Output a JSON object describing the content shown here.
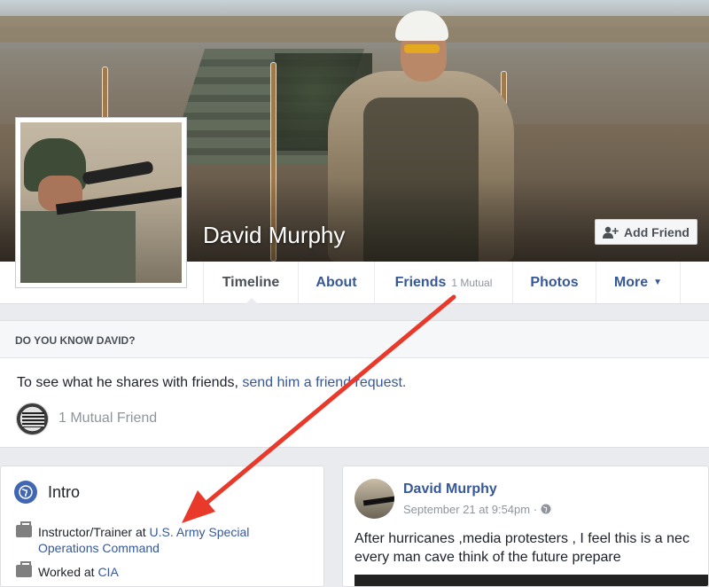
{
  "profile": {
    "name": "David Murphy",
    "add_friend_label": "Add Friend"
  },
  "tabs": [
    {
      "label": "Timeline",
      "active": true
    },
    {
      "label": "About"
    },
    {
      "label": "Friends",
      "sub": "1 Mutual"
    },
    {
      "label": "Photos"
    },
    {
      "label": "More"
    }
  ],
  "know_card": {
    "header": "DO YOU KNOW DAVID?",
    "text_prefix": "To see what he shares with friends, ",
    "link_text": "send him a friend request.",
    "mutual_label": "1 Mutual Friend"
  },
  "intro": {
    "title": "Intro",
    "line1_prefix": "Instructor/Trainer at ",
    "line1_link_a": "U.S. Army Special",
    "line1_link_b": "Operations Command",
    "line2_prefix": "Worked at ",
    "line2_link": "CIA"
  },
  "post": {
    "author": "David Murphy",
    "meta": "September 21 at 9:54pm ·",
    "line1": "After hurricanes ,media protesters , I feel this is a nec",
    "line2": "every man cave think of the future prepare"
  },
  "colors": {
    "link": "#365899",
    "annotation_arrow": "#e8392b"
  }
}
